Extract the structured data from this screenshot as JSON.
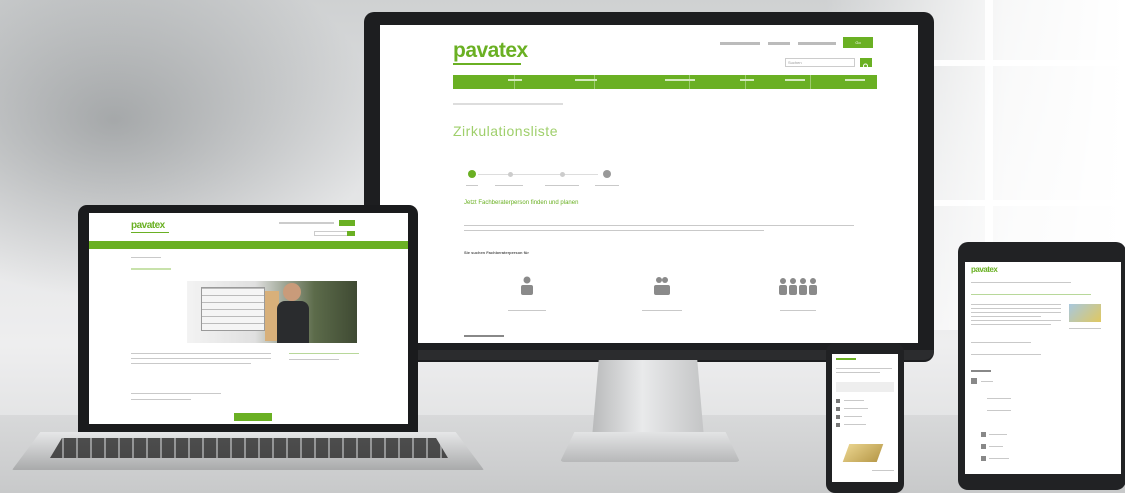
{
  "brand": {
    "logo_text": "pavatex",
    "accent_color": "#6ab023"
  },
  "imac": {
    "page_heading": "Zirkulationsliste",
    "step_heading": "Jetzt Fachberaterperson finden und planen",
    "section_heading": "Sie suchen Fachberaterperson für",
    "cta_label": "Go",
    "search_placeholder": "Suchen"
  },
  "icons": [
    "person-icon",
    "group-icon",
    "team-icon",
    "search-icon",
    "gear-icon"
  ]
}
